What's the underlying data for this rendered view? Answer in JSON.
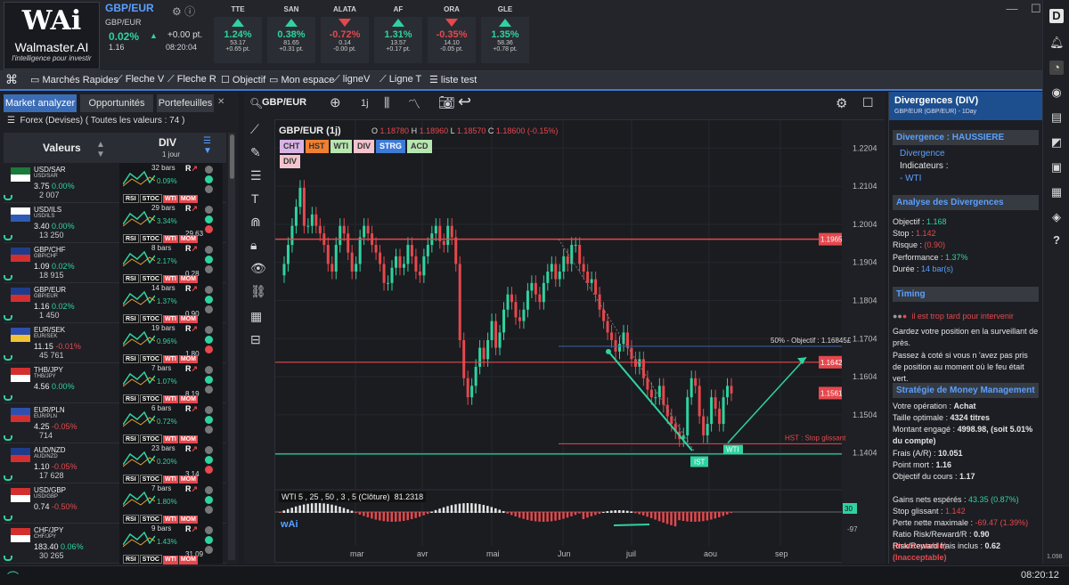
{
  "brand": {
    "name": "Walmaster.AI",
    "tagline": "l'intelligence pour investir",
    "mark": "WAi"
  },
  "main_quote": {
    "symbol": "GBP/EUR",
    "sub": "GBP/EUR",
    "pct": "0.02%",
    "pts": "+0.00 pt.",
    "price": "1.16",
    "time": "08:20:04"
  },
  "tickers": [
    {
      "name": "TTE",
      "pct": "1.24%",
      "dir": "up",
      "l1": "53.17",
      "l2": "+0.65 pt."
    },
    {
      "name": "SAN",
      "pct": "0.38%",
      "dir": "up",
      "l1": "81.65",
      "l2": "+0.31 pt."
    },
    {
      "name": "ALATA",
      "pct": "-0.72%",
      "dir": "down",
      "l1": "0.14",
      "l2": "-0.00 pt."
    },
    {
      "name": "AF",
      "pct": "1.31%",
      "dir": "up",
      "l1": "13.57",
      "l2": "+0.17 pt."
    },
    {
      "name": "ORA",
      "pct": "-0.35%",
      "dir": "down",
      "l1": "14.10",
      "l2": "-0.05 pt."
    },
    {
      "name": "GLE",
      "pct": "1.35%",
      "dir": "up",
      "l1": "58.36",
      "l2": "+0.78 pt."
    }
  ],
  "toolbar": [
    "Marchés Rapides",
    "Fleche V",
    "Fleche R",
    "Objectif",
    "Mon espace",
    "ligneV",
    "Ligne T",
    "liste test"
  ],
  "left": {
    "tabs": [
      "Market analyzer",
      "Opportunités",
      "Portefeuilles"
    ],
    "filter": "Forex (Devises) ( Toutes les valeurs : 74 )",
    "col_valeurs": "Valeurs",
    "col_div": "DIV",
    "col_div_sub": "1 jour"
  },
  "rows": [
    {
      "sym": "USD/SAR",
      "s2": "USD/SAR",
      "price": "3.75",
      "pct": "0.00%",
      "pdir": "g",
      "vol": "2 007",
      "bars": "32 bars",
      "ipct": "0.09%",
      "idir": "g",
      "v2": "",
      "flag": [
        "#1a7a3a",
        "#fff"
      ]
    },
    {
      "sym": "USD/ILS",
      "s2": "USD/ILS",
      "price": "3.40",
      "pct": "0.00%",
      "pdir": "g",
      "vol": "13 250",
      "bars": "29 bars",
      "ipct": "3.34%",
      "idir": "g",
      "v2": "29.63",
      "flag": [
        "#fff",
        "#2d5bb5"
      ]
    },
    {
      "sym": "GBP/CHF",
      "s2": "GBP/CHF",
      "price": "1.09",
      "pct": "0.02%",
      "pdir": "g",
      "vol": "18 915",
      "bars": "8 bars",
      "ipct": "2.17%",
      "idir": "g",
      "v2": "0.28",
      "flag": [
        "#1f3c8c",
        "#d32f2f"
      ]
    },
    {
      "sym": "GBP/EUR",
      "s2": "GBP/EUR",
      "price": "1.16",
      "pct": "0.02%",
      "pdir": "g",
      "vol": "1 450",
      "bars": "14 bars",
      "ipct": "1.37%",
      "idir": "g",
      "v2": "0.90",
      "flag": [
        "#1f3c8c",
        "#d32f2f"
      ]
    },
    {
      "sym": "EUR/SEK",
      "s2": "EUR/SEK",
      "price": "11.15",
      "pct": "-0.01%",
      "pdir": "r",
      "vol": "45 761",
      "bars": "19 bars",
      "ipct": "0.96%",
      "idir": "g",
      "v2": "1.80",
      "flag": [
        "#2d4fb0",
        "#f1c232"
      ]
    },
    {
      "sym": "THB/JPY",
      "s2": "THB/JPY",
      "price": "4.56",
      "pct": "0.00%",
      "pdir": "g",
      "vol": "",
      "bars": "7 bars",
      "ipct": "1.07%",
      "idir": "g",
      "v2": "8.19",
      "flag": [
        "#d32f2f",
        "#fff"
      ]
    },
    {
      "sym": "EUR/PLN",
      "s2": "EUR/PLN",
      "price": "4.25",
      "pct": "-0.05%",
      "pdir": "r",
      "vol": "714",
      "bars": "6 bars",
      "ipct": "0.72%",
      "idir": "g",
      "v2": "",
      "flag": [
        "#2d4fb0",
        "#d32f2f"
      ]
    },
    {
      "sym": "AUD/NZD",
      "s2": "AUD/NZD",
      "price": "1.10",
      "pct": "-0.05%",
      "pdir": "r",
      "vol": "17 628",
      "bars": "23 bars",
      "ipct": "0.20%",
      "idir": "g",
      "v2": "3.14",
      "flag": [
        "#1f3c8c",
        "#d32f2f"
      ]
    },
    {
      "sym": "USD/GBP",
      "s2": "USD/GBP",
      "price": "0.74",
      "pct": "-0.50%",
      "pdir": "r",
      "vol": "",
      "bars": "7 bars",
      "ipct": "1.80%",
      "idir": "g",
      "v2": "",
      "flag": [
        "#d32f2f",
        "#fff"
      ]
    },
    {
      "sym": "CHF/JPY",
      "s2": "CHF/JPY",
      "price": "183.40",
      "pct": "0.06%",
      "pdir": "g",
      "vol": "30 265",
      "bars": "9 bars",
      "ipct": "1.43%",
      "idir": "g",
      "v2": "31.09",
      "flag": [
        "#d32f2f",
        "#fff"
      ]
    }
  ],
  "chart": {
    "symbol": "GBP/EUR",
    "title": "GBP/EUR (1j)",
    "ohlc": {
      "o": "1.18780",
      "h": "1.18960",
      "l": "1.18570",
      "c": "1.18600 (-0.15%)"
    },
    "tf": "1j",
    "tags": [
      {
        "t": "CHT",
        "c": "#d9b3e6"
      },
      {
        "t": "HST",
        "c": "#f08030"
      },
      {
        "t": "WTI",
        "c": "#b8e6b0"
      },
      {
        "t": "DIV",
        "c": "#f2c4cc"
      },
      {
        "t": "STRG",
        "c": "#3d7bd6"
      },
      {
        "t": "ACD",
        "c": "#b8e6b0"
      },
      {
        "t": "DIV",
        "c": "#f2c4cc"
      }
    ],
    "yticks": [
      "1.2204",
      "1.2104",
      "1.2004",
      "1.1904",
      "1.1804",
      "1.1704",
      "1.1604",
      "1.1504",
      "1.1404"
    ],
    "xticks": [
      "mar",
      "avr",
      "mai",
      "Jun",
      "juil",
      "aou",
      "sep"
    ],
    "levels": [
      {
        "label": "1.1965",
        "v": 1.1965
      },
      {
        "label": "1.1642",
        "v": 1.1642
      },
      {
        "label": "1.1561",
        "v": 1.1561
      }
    ],
    "objective_text": "50% - Objectif : 1.16845£",
    "hst_text": "HST : Stop glissant",
    "ist": "IST",
    "wti": "WTI",
    "osc_label": "WTI 5 , 25 , 50 , 3 , 5 (Clôture)",
    "osc_value": "81.2318",
    "osc_top": "30",
    "osc_bot": "-97"
  },
  "right": {
    "title": "Divergences (DIV)",
    "sub": "GBP/EUR (GBP/EUR) - 1Day",
    "s1": "Divergence : HAUSSIERE",
    "div_word": "Divergence",
    "ind_word": "Indicateurs :",
    "wti": "- WTI",
    "s2": "Analyse des Divergences",
    "obj_l": "Objectif : ",
    "obj_v": "1.168",
    "stop_l": "Stop : ",
    "stop_v": "1.142",
    "risk_l": "Risque : ",
    "risk_v": "(0.90)",
    "perf_l": "Performance : ",
    "perf_v": "1.37%",
    "dur_l": "Durée : ",
    "dur_v": "14 bar(s)",
    "s3": "Timing",
    "timing_warn": "il est trop tard pour intervenir",
    "timing_t1": "Gardez votre position en la surveillant de près.",
    "timing_t2": "Passez à coté si vous n 'avez pas pris de position au moment où le feu était vert.",
    "s4": "Stratégie de Money Management",
    "op_l": "Votre opération : ",
    "op_v": "Achat",
    "size_l": "Taille optimale : ",
    "size_v": "4324 titres",
    "mont_l": "Montant engagé : ",
    "mont_v": "4998.98,",
    "mont_s": "(soit 5.01% du compte)",
    "frais_l": "Frais (A/R) : ",
    "frais_v": "10.051",
    "pm_l": "Point mort : ",
    "pm_v": "1.16",
    "oc_l": "Objectif du cours : ",
    "oc_v": "1.17",
    "gain_l": "Gains nets espérés : ",
    "gain_v": "43.35 (0.87%)",
    "sg_l": "Stop glissant : ",
    "sg_v": "1.142",
    "pm2_l": "Perte nette maximale : ",
    "pm2_v": "-69.47 (1.39%)",
    "rr_l": "Ratio Risk/Reward/R : ",
    "rr_v": "0.90",
    "rr_s": "(Inacceptable)",
    "rrf_l": "Risk/Reward frais inclus : ",
    "rrf_v": "0.62",
    "rrf_s": "(Inacceptable)"
  },
  "sidebar_version": "1.098",
  "status_time": "08:20:12"
}
